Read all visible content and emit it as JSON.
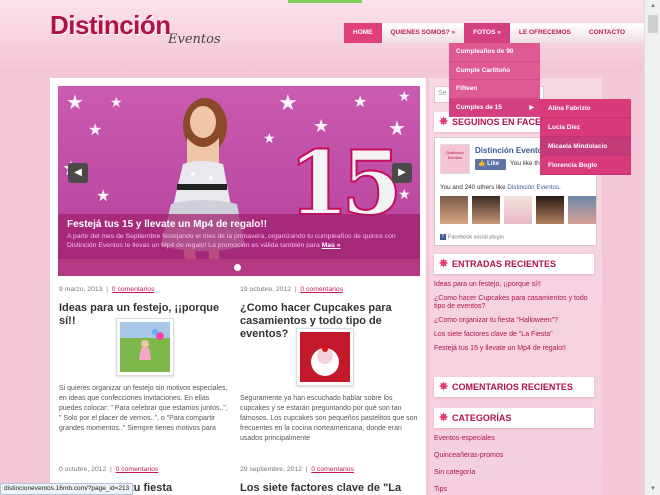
{
  "site": {
    "logo_main": "Distinción",
    "logo_script": "Eventos"
  },
  "nav": {
    "items": [
      "HOME",
      "QUIENES SOMOS? »",
      "FOTOS »",
      "LE OFRECEMOS",
      "CONTACTO"
    ],
    "fotos_menu": [
      "Cumpleaños de 90",
      "Cumple Carlitoño",
      "Fifteen",
      "Cumples de 15"
    ],
    "cumples_submenu": [
      "Alina Fabrizio",
      "Lucía Díez",
      "Micaela Mindolacio",
      "Florencia Boglo"
    ]
  },
  "slider": {
    "title": "Festejá tus 15 y llevate un Mp4 de regalo!!",
    "text": "A partir del mes de Septiembre festejando el mes de la primavera, organizando tu cumpleaños de quince con Distinción Eventos te llevas un Mp4 de regalo! La promoción es válida también para",
    "more": "Mas »",
    "big_number": "15",
    "plus": "+"
  },
  "posts": [
    {
      "date": "9 marzo, 2013",
      "sep": "|",
      "comments": "0 comentarios",
      "title": "Ideas para un festejo, ¡¡porque sí!!",
      "excerpt": "Si quieres organizar un festejo sin motivos especiales, en ideas que confecciones invitaciones. En ellas puedes colocar: \" Para celebrar que estamos juntos..\", \" Solo por el placer de vernos..\", o \"Para compartir grandes momentos..\" Siempre tienes motivos para"
    },
    {
      "date": "19 octubre, 2012",
      "sep": "|",
      "comments": "0 comentarios",
      "title": "¿Como hacer Cupcakes para casamientos y todo tipo de eventos?",
      "excerpt": "Seguramente ya han escuchado hablar sobre los cupcakes y se estarán preguntando por qué son tan famosos. Los cupcakes son pequeños pastelitos que son frecuentes en la cocina norteamericana, donde eran usados principalmente"
    },
    {
      "date": "0 octubre, 2012",
      "sep": "|",
      "comments": "0 comentarios",
      "title": "tu fiesta \"Halloween\"?"
    },
    {
      "date": "29 septiembre, 2012",
      "sep": "|",
      "comments": "0 comentarios",
      "title": "Los siete factores clave de \"La Fiesta\""
    }
  ],
  "sidebar": {
    "search_placeholder": "Se",
    "follow_title": "Seguinos en Facebook",
    "fb": {
      "logo_text": "Distinción Eventos",
      "name": "Distinción Eventos",
      "like_label": "Like",
      "like_this": "You like this.",
      "others_prefix": "You and 240 others like ",
      "others_link": "Distinción Eventos.",
      "plugin": "Facebook social plugin",
      "fb_letter": "f"
    },
    "recent_title": "Entradas Recientes",
    "recent": [
      "Ideas para un festejo, ¡¡porque sí!!",
      "¿Como hacer Cupcakes para casamientos y todo tipo de eventos?",
      "¿Como organizar tu fiesta \"Halloween\"?",
      "Los siete factores clave de \"La Fiesta\"",
      "Festejá tus 15 y llevate un Mp4 de regalo!!"
    ],
    "comments_title": "Comentarios Recientes",
    "categories_title": "Categorías",
    "categories": [
      "Eventos-especiales",
      "Quinceañeras-promos",
      "Sin categoría",
      "Tips"
    ]
  },
  "status_bar": "distincioneventos.16mb.com/?page_id=213",
  "colors": {
    "accent": "#c2185b",
    "menu": "#e05a92",
    "submenu": "#d93a7a",
    "bg": "#f3c6d8"
  }
}
